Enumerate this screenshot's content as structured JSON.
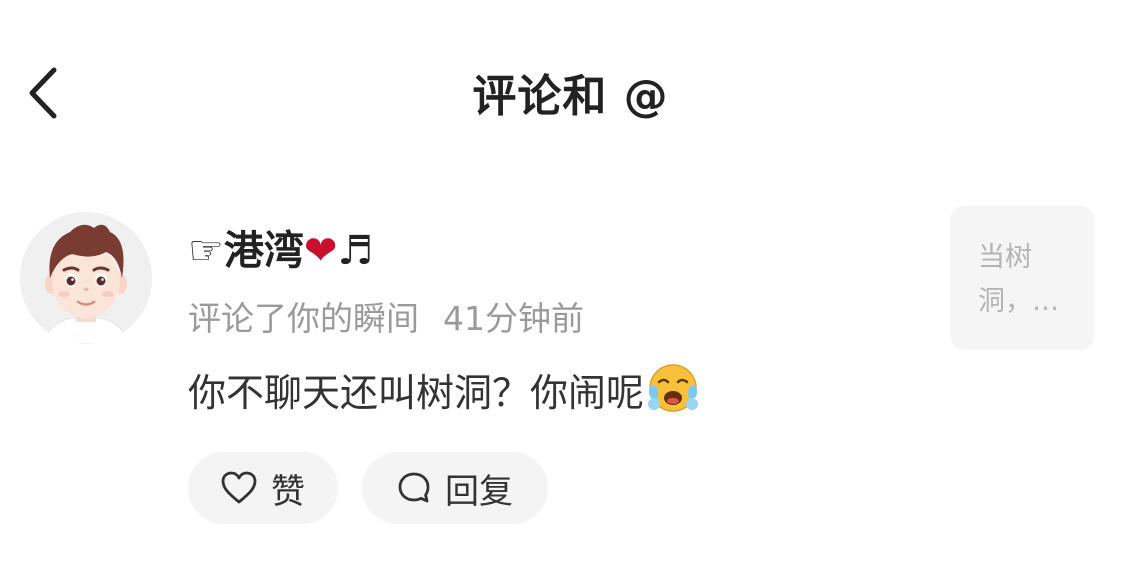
{
  "header": {
    "title": "评论和 @",
    "back_icon": "chevron-left-icon"
  },
  "notification": {
    "avatar_icon": "avatar-boy-icon",
    "username": {
      "prefix": "☞",
      "name": "港湾",
      "heart": "❤",
      "note": "♬"
    },
    "action": "评论了你的瞬间",
    "time": "41分钟前",
    "comment": "你不聊天还叫树洞？你闹呢",
    "comment_emoji": "crying-face-emoji",
    "like": {
      "label": "赞",
      "icon": "heart-outline-icon"
    },
    "reply": {
      "label": "回复",
      "icon": "comment-bubble-icon"
    },
    "preview_text": "当树洞，…"
  },
  "colors": {
    "text_primary": "#222222",
    "text_secondary": "#9a9a9a",
    "pill_bg": "#f4f4f4",
    "preview_bg": "#f5f5f5",
    "heart_red": "#c8102e"
  }
}
